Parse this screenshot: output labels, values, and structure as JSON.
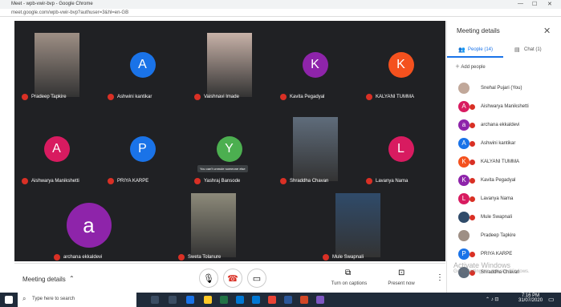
{
  "browser": {
    "title": "Meet - wpb-vwir-bvp - Google Chrome",
    "url": "meet.google.com/wpb-vwir-bvp?authuser=3&hl=en-GB"
  },
  "tiles": [
    {
      "name": "Pradeep Tapkire",
      "type": "video",
      "color": "#9e8f85"
    },
    {
      "name": "Ashwini kantikar",
      "type": "avatar",
      "letter": "A",
      "color": "#1a73e8"
    },
    {
      "name": "Vaishnavi Imade",
      "type": "video",
      "color": "#c8b2a8"
    },
    {
      "name": "Kavita Pegadyal",
      "type": "avatar",
      "letter": "K",
      "color": "#8e24aa"
    },
    {
      "name": "KALYANI TUMMA",
      "type": "avatar",
      "letter": "K",
      "color": "#f4511e"
    },
    {
      "name": "Aishwarya Manikshetti",
      "type": "avatar",
      "letter": "A",
      "color": "#d81b60"
    },
    {
      "name": "PRIYA KARPE",
      "type": "avatar",
      "letter": "P",
      "color": "#1a73e8"
    },
    {
      "name": "Yashraj Bansode",
      "type": "avatar",
      "letter": "Y",
      "color": "#4caf50",
      "tooltip": "You can't unmute someone else"
    },
    {
      "name": "Shraddha Chavan",
      "type": "video",
      "color": "#5f6c7b"
    },
    {
      "name": "Lavanya Nama",
      "type": "avatar",
      "letter": "L",
      "color": "#d81b60"
    },
    {
      "name": "archana ekkaldevi",
      "type": "avatar",
      "letter": "a",
      "color": "#8e24aa",
      "big": true
    },
    {
      "name": "Sweta Tolanure",
      "type": "video",
      "color": "#8d8a7a"
    },
    {
      "name": "Mule Swapnali",
      "type": "video",
      "color": "#304b6a"
    }
  ],
  "bottom": {
    "meeting_details": "Meeting details",
    "turn_on_captions": "Turn on captions",
    "present_now": "Present now"
  },
  "side": {
    "title": "Meeting details",
    "tab_people": "People (14)",
    "tab_chat": "Chat (1)",
    "add_people": "Add people",
    "people": [
      {
        "name": "Snehal Pujari (You)",
        "letter": "",
        "color": "#c1a89a",
        "muted": false
      },
      {
        "name": "Aishwarya Manikshetti",
        "letter": "A",
        "color": "#d81b60",
        "muted": true
      },
      {
        "name": "archana ekkaldevi",
        "letter": "a",
        "color": "#8e24aa",
        "muted": true
      },
      {
        "name": "Ashwini kantikar",
        "letter": "A",
        "color": "#1a73e8",
        "muted": true
      },
      {
        "name": "KALYANI TUMMA",
        "letter": "K",
        "color": "#f4511e",
        "muted": true
      },
      {
        "name": "Kavita Pegadyal",
        "letter": "K",
        "color": "#8e24aa",
        "muted": true
      },
      {
        "name": "Lavanya Nama",
        "letter": "L",
        "color": "#d81b60",
        "muted": true
      },
      {
        "name": "Mule Swapnali",
        "letter": "",
        "color": "#304b6a",
        "muted": true
      },
      {
        "name": "Pradeep Tapkire",
        "letter": "",
        "color": "#9e8f85",
        "muted": false
      },
      {
        "name": "PRIYA KARPE",
        "letter": "P",
        "color": "#1a73e8",
        "muted": true
      },
      {
        "name": "Shraddha Chavan",
        "letter": "",
        "color": "#5f6c7b",
        "muted": true
      }
    ],
    "watermark_line1": "Activate Windows",
    "watermark_line2": "Go to Settings to activate Windows."
  },
  "taskbar": {
    "search_placeholder": "Type here to search",
    "time": "7:16 PM",
    "date": "31/07/2020"
  }
}
